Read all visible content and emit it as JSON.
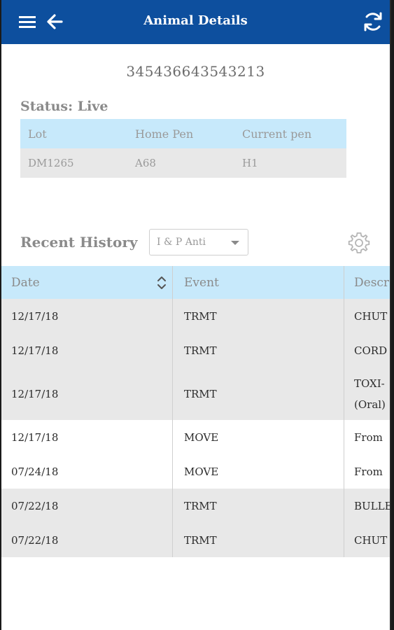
{
  "header": {
    "title": "Animal Details",
    "menu_icon": "hamburger-menu-icon",
    "back_icon": "arrow-left-icon",
    "refresh_icon": "refresh-icon"
  },
  "animal": {
    "id": "345436643543213",
    "status": "Status: Live"
  },
  "status_table": {
    "headers": [
      "Lot",
      "Home Pen",
      "Current pen"
    ],
    "values": [
      "DM1265",
      "A68",
      "H1"
    ]
  },
  "history": {
    "label": "Recent History",
    "filter_value": "I & P Anti",
    "settings_icon": "gear-icon",
    "columns": [
      "Date",
      "Event",
      "Descr"
    ],
    "rows": [
      {
        "date": "12/17/18",
        "event": "TRMT",
        "desc": "CHUT"
      },
      {
        "date": "12/17/18",
        "event": "TRMT",
        "desc": "CORD"
      },
      {
        "date": "12/17/18",
        "event": "TRMT",
        "desc": "TOXI-(Oral)"
      },
      {
        "date": "12/17/18",
        "event": "MOVE",
        "desc": "From"
      },
      {
        "date": "07/24/18",
        "event": "MOVE",
        "desc": "From"
      },
      {
        "date": "07/22/18",
        "event": "TRMT",
        "desc": "BULLE"
      },
      {
        "date": "07/22/18",
        "event": "TRMT",
        "desc": "CHUT"
      }
    ]
  },
  "colors": {
    "appbar": "#0d4f9e",
    "table_header": "#c7e9fb",
    "row_grey": "#e8e8e8"
  }
}
